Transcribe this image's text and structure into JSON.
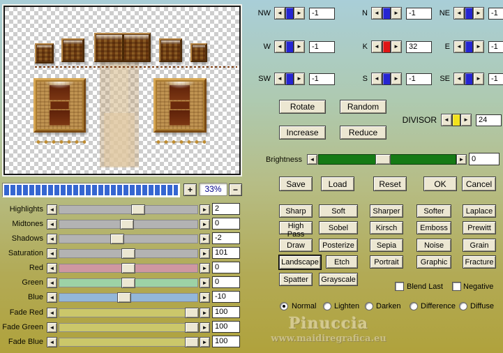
{
  "icons": {
    "arrow_left": "◄",
    "arrow_right": "►",
    "plus": "+",
    "minus": "−"
  },
  "zoom_control": {
    "percent": "33%"
  },
  "adjust_sliders": [
    {
      "label": "Highlights",
      "value": "2",
      "track": "#b3b3b3",
      "thumb_left": "57%"
    },
    {
      "label": "Midtones",
      "value": "0",
      "track": "#b3b3b3",
      "thumb_left": "49%"
    },
    {
      "label": "Shadows",
      "value": "-2",
      "track": "#b3b3b3",
      "thumb_left": "42%"
    },
    {
      "label": "Saturation",
      "value": "101",
      "track": "#b3b3b3",
      "thumb_left": "50%"
    },
    {
      "label": "Red",
      "value": "0",
      "track": "#cf97a1",
      "thumb_left": "50%"
    },
    {
      "label": "Green",
      "value": "0",
      "track": "#9dd2a6",
      "thumb_left": "50%"
    },
    {
      "label": "Blue",
      "value": "-10",
      "track": "#93b7d9",
      "thumb_left": "47%"
    },
    {
      "label": "Fade Red",
      "value": "100",
      "track": "#cbc76a",
      "thumb_left": "96%"
    },
    {
      "label": "Fade Green",
      "value": "100",
      "track": "#cbc76a",
      "thumb_left": "96%"
    },
    {
      "label": "Fade Blue",
      "value": "100",
      "track": "#cbc76a",
      "thumb_left": "96%"
    }
  ],
  "matrix": {
    "cells": [
      {
        "label": "NW",
        "value": "-1",
        "thumb_color": "#2525d2"
      },
      {
        "label": "N",
        "value": "-1",
        "thumb_color": "#2525d2"
      },
      {
        "label": "NE",
        "value": "-1",
        "thumb_color": "#2525d2"
      },
      {
        "label": "W",
        "value": "-1",
        "thumb_color": "#2525d2"
      },
      {
        "label": "K",
        "value": "32",
        "thumb_color": "#e01515"
      },
      {
        "label": "E",
        "value": "-1",
        "thumb_color": "#2525d2"
      },
      {
        "label": "SW",
        "value": "-1",
        "thumb_color": "#2525d2"
      },
      {
        "label": "S",
        "value": "-1",
        "thumb_color": "#2525d2"
      },
      {
        "label": "SE",
        "value": "-1",
        "thumb_color": "#2525d2"
      }
    ]
  },
  "action_buttons": {
    "rotate": "Rotate",
    "random": "Random",
    "increase": "Increase",
    "reduce": "Reduce"
  },
  "divisor": {
    "label": "DIVISOR",
    "value": "24",
    "thumb_color": "#f2e21c"
  },
  "brightness": {
    "label": "Brightness",
    "value": "0",
    "track": "#157a15",
    "thumb_left": "47%"
  },
  "main_buttons": {
    "save": "Save",
    "load": "Load",
    "reset": "Reset",
    "ok": "OK",
    "cancel": "Cancel"
  },
  "filters": {
    "items": [
      {
        "label": "Sharp"
      },
      {
        "label": "Soft"
      },
      {
        "label": "Sharper"
      },
      {
        "label": "Softer"
      },
      {
        "label": "Laplace"
      },
      {
        "label": "High Pass"
      },
      {
        "label": "Sobel"
      },
      {
        "label": "Kirsch"
      },
      {
        "label": "Emboss"
      },
      {
        "label": "Prewitt"
      },
      {
        "label": "Draw"
      },
      {
        "label": "Posterize"
      },
      {
        "label": "Sepia"
      },
      {
        "label": "Noise"
      },
      {
        "label": "Grain"
      },
      {
        "label": "Landscape",
        "focused": true
      },
      {
        "label": "Etch"
      },
      {
        "label": "Portrait"
      },
      {
        "label": "Graphic"
      },
      {
        "label": "Fracture"
      },
      {
        "label": "Spatter"
      },
      {
        "label": "Grayscale"
      }
    ]
  },
  "checkboxes": [
    {
      "label": "Blend Last",
      "checked": false
    },
    {
      "label": "Negative",
      "checked": false
    }
  ],
  "blend_modes": [
    {
      "label": "Normal",
      "selected": true
    },
    {
      "label": "Lighten",
      "selected": false
    },
    {
      "label": "Darken",
      "selected": false
    },
    {
      "label": "Difference",
      "selected": false
    },
    {
      "label": "Diffuse",
      "selected": false
    }
  ],
  "watermark": {
    "name": "Pinuccia",
    "site": "www.maidiregrafica.eu"
  },
  "colors": {
    "bg_top": "#a9ced8",
    "bg_mid": "#b6bd86",
    "bg_bottom": "#b0a23c",
    "button_face": "#ece7d2",
    "progress_segment": "#3566d1",
    "percent_text": "#00008b",
    "preview_checker": "#cdcdcd",
    "brightness_track": "#157a15"
  }
}
